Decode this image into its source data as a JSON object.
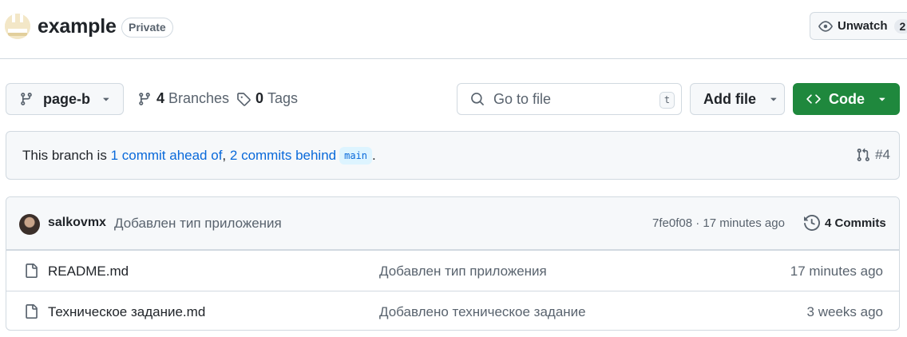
{
  "header": {
    "repo_name": "example",
    "visibility": "Private",
    "watch_label": "Unwatch",
    "watch_count": "2"
  },
  "toolbar": {
    "branch": "page-b",
    "branches_count": "4",
    "branches_label": "Branches",
    "tags_count": "0",
    "tags_label": "Tags",
    "search_placeholder": "Go to file",
    "search_shortcut": "t",
    "add_file_label": "Add file",
    "code_label": "Code"
  },
  "branch_info": {
    "prefix": "This branch is",
    "ahead": "1 commit ahead of",
    "separator": ",",
    "behind": "2 commits behind",
    "base": "main",
    "suffix": ".",
    "pr": "#4"
  },
  "latest_commit": {
    "author": "salkovmx",
    "message": "Добавлен тип приложения",
    "meta": "7fe0f08 · 17 minutes ago",
    "commits_label": "4 Commits"
  },
  "files": [
    {
      "name": "README.md",
      "message": "Добавлен тип приложения",
      "date": "17 minutes ago"
    },
    {
      "name": "Техническое задание.md",
      "message": "Добавлено техническое задание",
      "date": "3 weeks ago"
    }
  ],
  "colors": {
    "accent_green": "#1f883d",
    "link_blue": "#0969da",
    "muted": "#59636e",
    "border": "#d1d9e0"
  },
  "icons": [
    "repo-avatar-icon",
    "eye-icon",
    "git-branch-icon",
    "tag-icon",
    "search-icon",
    "chevron-down-icon",
    "code-icon",
    "pull-request-icon",
    "history-icon",
    "file-icon"
  ]
}
